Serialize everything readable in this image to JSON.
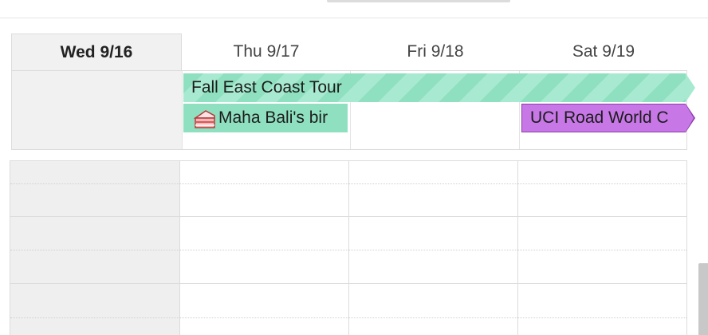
{
  "days": [
    {
      "label": "Wed 9/16",
      "today": true
    },
    {
      "label": "Thu 9/17",
      "today": false
    },
    {
      "label": "Fri 9/18",
      "today": false
    },
    {
      "label": "Sat 9/19",
      "today": false
    }
  ],
  "events": {
    "tour": {
      "title": "Fall East Coast Tour",
      "color": "#8fe0c0"
    },
    "birthday": {
      "title": "Maha Bali's bir",
      "icon": "cake-icon",
      "color": "#8fe0c0"
    },
    "uci": {
      "title": "UCI Road World C",
      "color": "#c778e6"
    }
  }
}
